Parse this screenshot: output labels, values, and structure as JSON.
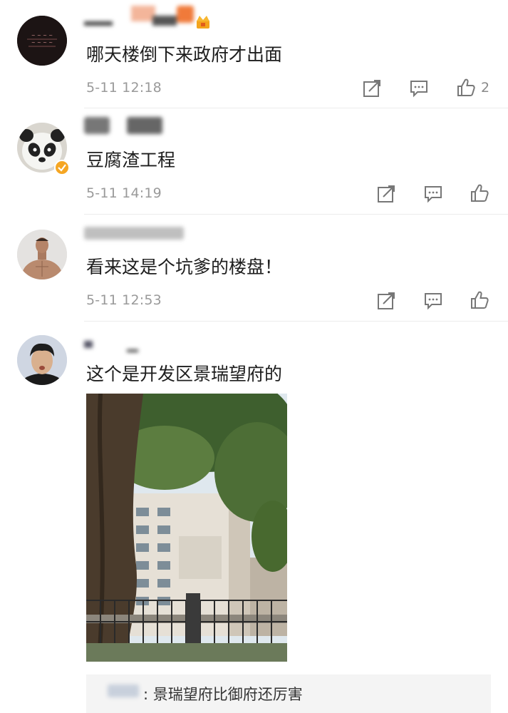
{
  "comments": [
    {
      "text": "哪天楼倒下来政府才出面",
      "time": "5-11 12:18",
      "likes": "2"
    },
    {
      "text": "豆腐渣工程",
      "time": "5-11 14:19",
      "likes": ""
    },
    {
      "text": "看来这是个坑爹的楼盘！",
      "time": "5-11 12:53",
      "likes": ""
    },
    {
      "text": "这个是开发区景瑞望府的",
      "time": "",
      "likes": ""
    }
  ],
  "reply": {
    "text": ": 景瑞望府比御府还厉害"
  },
  "icons": {
    "share": "share-icon",
    "comment": "comment-icon",
    "like": "thumbs-up-icon",
    "verified": "verified-badge-icon"
  },
  "colors": {
    "meta": "#9a9a9a",
    "verified": "#f5a623",
    "reply_bg": "#f4f4f4"
  }
}
